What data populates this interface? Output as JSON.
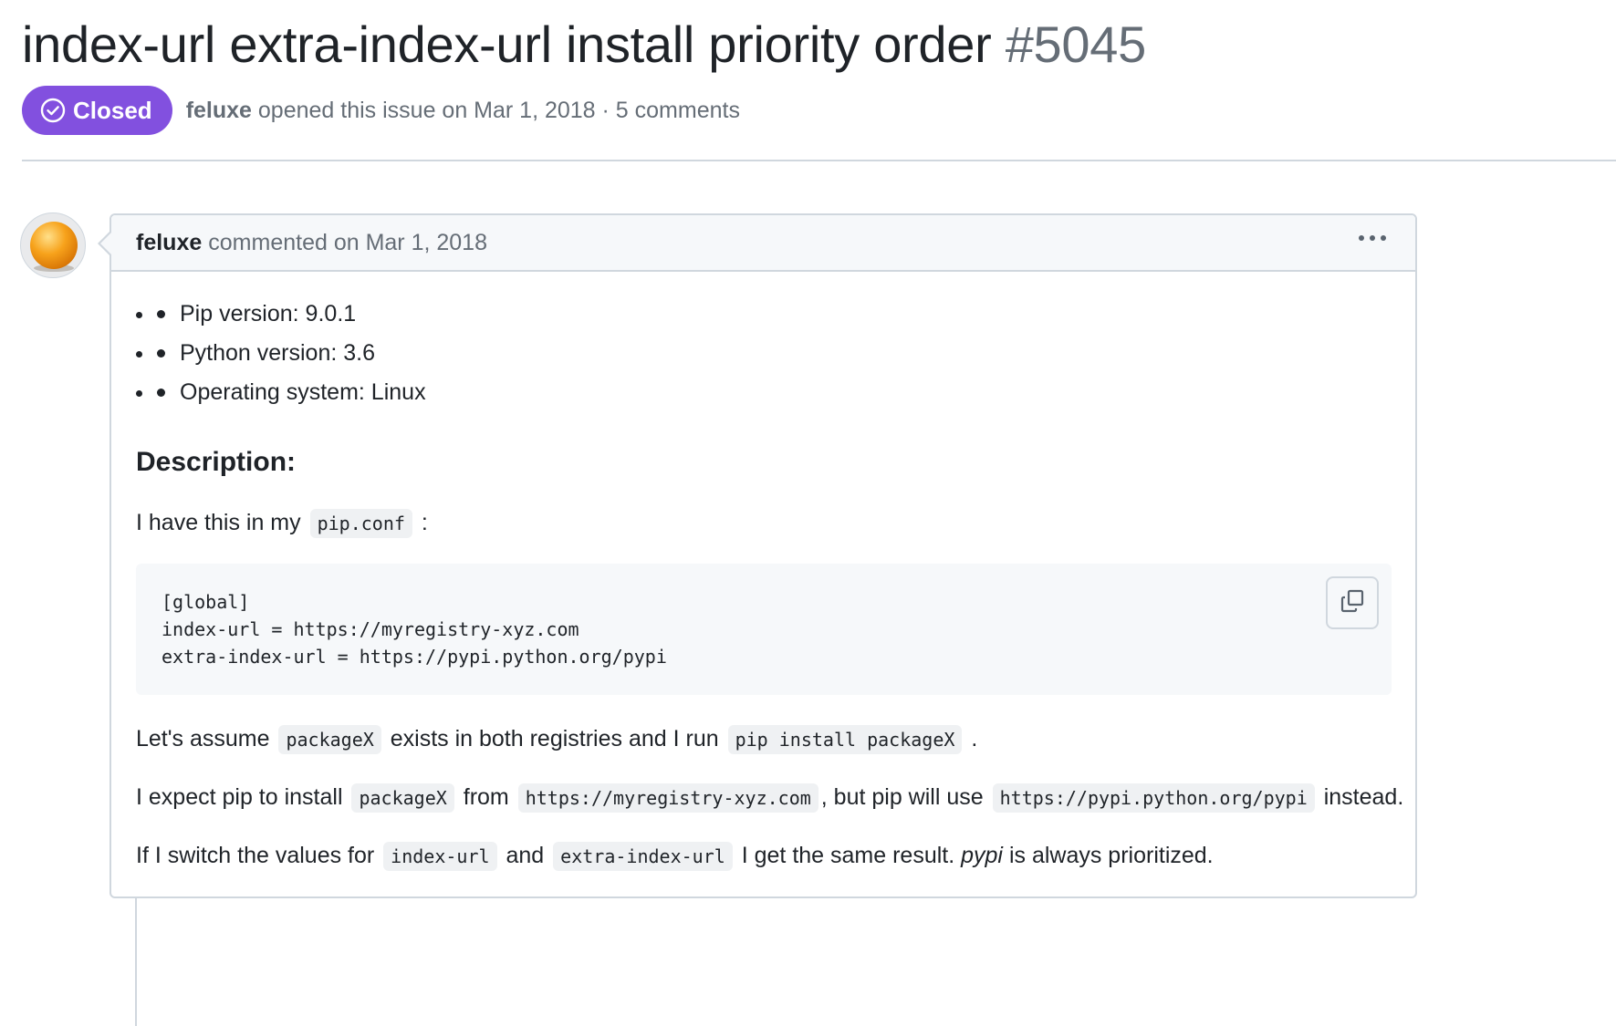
{
  "issue": {
    "title": "index-url extra-index-url install priority order",
    "number": "#5045",
    "state": "Closed",
    "state_color": "#8250df",
    "author": "feluxe",
    "meta_rest": " opened this issue on Mar 1, 2018 · 5 comments"
  },
  "comment": {
    "author": "feluxe",
    "action": "commented on Mar 1, 2018",
    "avatar_icon": "orange-ball-avatar",
    "menu_icon": "kebab-horizontal-icon",
    "env_list": [
      "Pip version: 9.0.1",
      "Python version: 3.6",
      "Operating system: Linux"
    ],
    "heading": "Description:",
    "p1": {
      "text1": "I have this in my ",
      "code1": "pip.conf",
      "text2": " :"
    },
    "code_block": "[global]\nindex-url = https://myregistry-xyz.com\nextra-index-url = https://pypi.python.org/pypi",
    "copy_icon": "copy-icon",
    "p2": {
      "text1": "Let's assume ",
      "code1": "packageX",
      "text2": " exists in both registries and I run ",
      "code2": "pip install packageX",
      "text3": " ."
    },
    "p3": {
      "text1": "I expect pip to install ",
      "code1": "packageX",
      "text2": " from ",
      "code2": "https://myregistry-xyz.com",
      "text3": ", but pip will use ",
      "code3": "https://pypi.python.org/pypi",
      "text4": " instead."
    },
    "p4": {
      "text1": "If I switch the values for ",
      "code1": "index-url",
      "text2": " and ",
      "code2": "extra-index-url",
      "text3": " I get the same result. ",
      "em1": "pypi",
      "text4": " is always prioritized."
    }
  }
}
